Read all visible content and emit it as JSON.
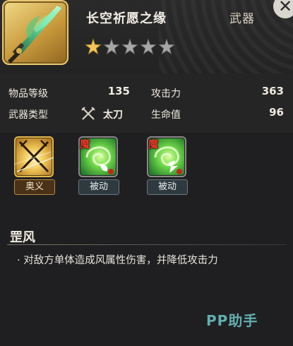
{
  "item": {
    "name": "长空祈愿之缘",
    "type": "武器",
    "stars": {
      "filled": 1,
      "total": 5
    }
  },
  "stats": {
    "level_label": "物品等级",
    "level_value": "135",
    "attack_label": "攻击力",
    "attack_value": "363",
    "weapon_type_label": "武器类型",
    "weapon_type_value": "太刀",
    "hp_label": "生命值",
    "hp_value": "96"
  },
  "skills": [
    {
      "tag": "奥义",
      "icon": "crossed-blades-icon"
    },
    {
      "badge": "魔",
      "tag": "被动",
      "icon": "wind-swirl-icon"
    },
    {
      "badge": "魔",
      "tag": "被动",
      "icon": "wind-swirl-icon"
    }
  ],
  "skill_detail": {
    "title": "罡风",
    "bullet": "·",
    "description": "对敌方单体造成风属性伤害，并降低攻击力"
  },
  "watermark": "PP助手",
  "colors": {
    "gold_frame": "#c89a3c",
    "passive_green": "#3fae3a",
    "demon_red": "#e53b2a",
    "star_gold": "#f2c45a",
    "star_grey": "#9a9a9a"
  }
}
